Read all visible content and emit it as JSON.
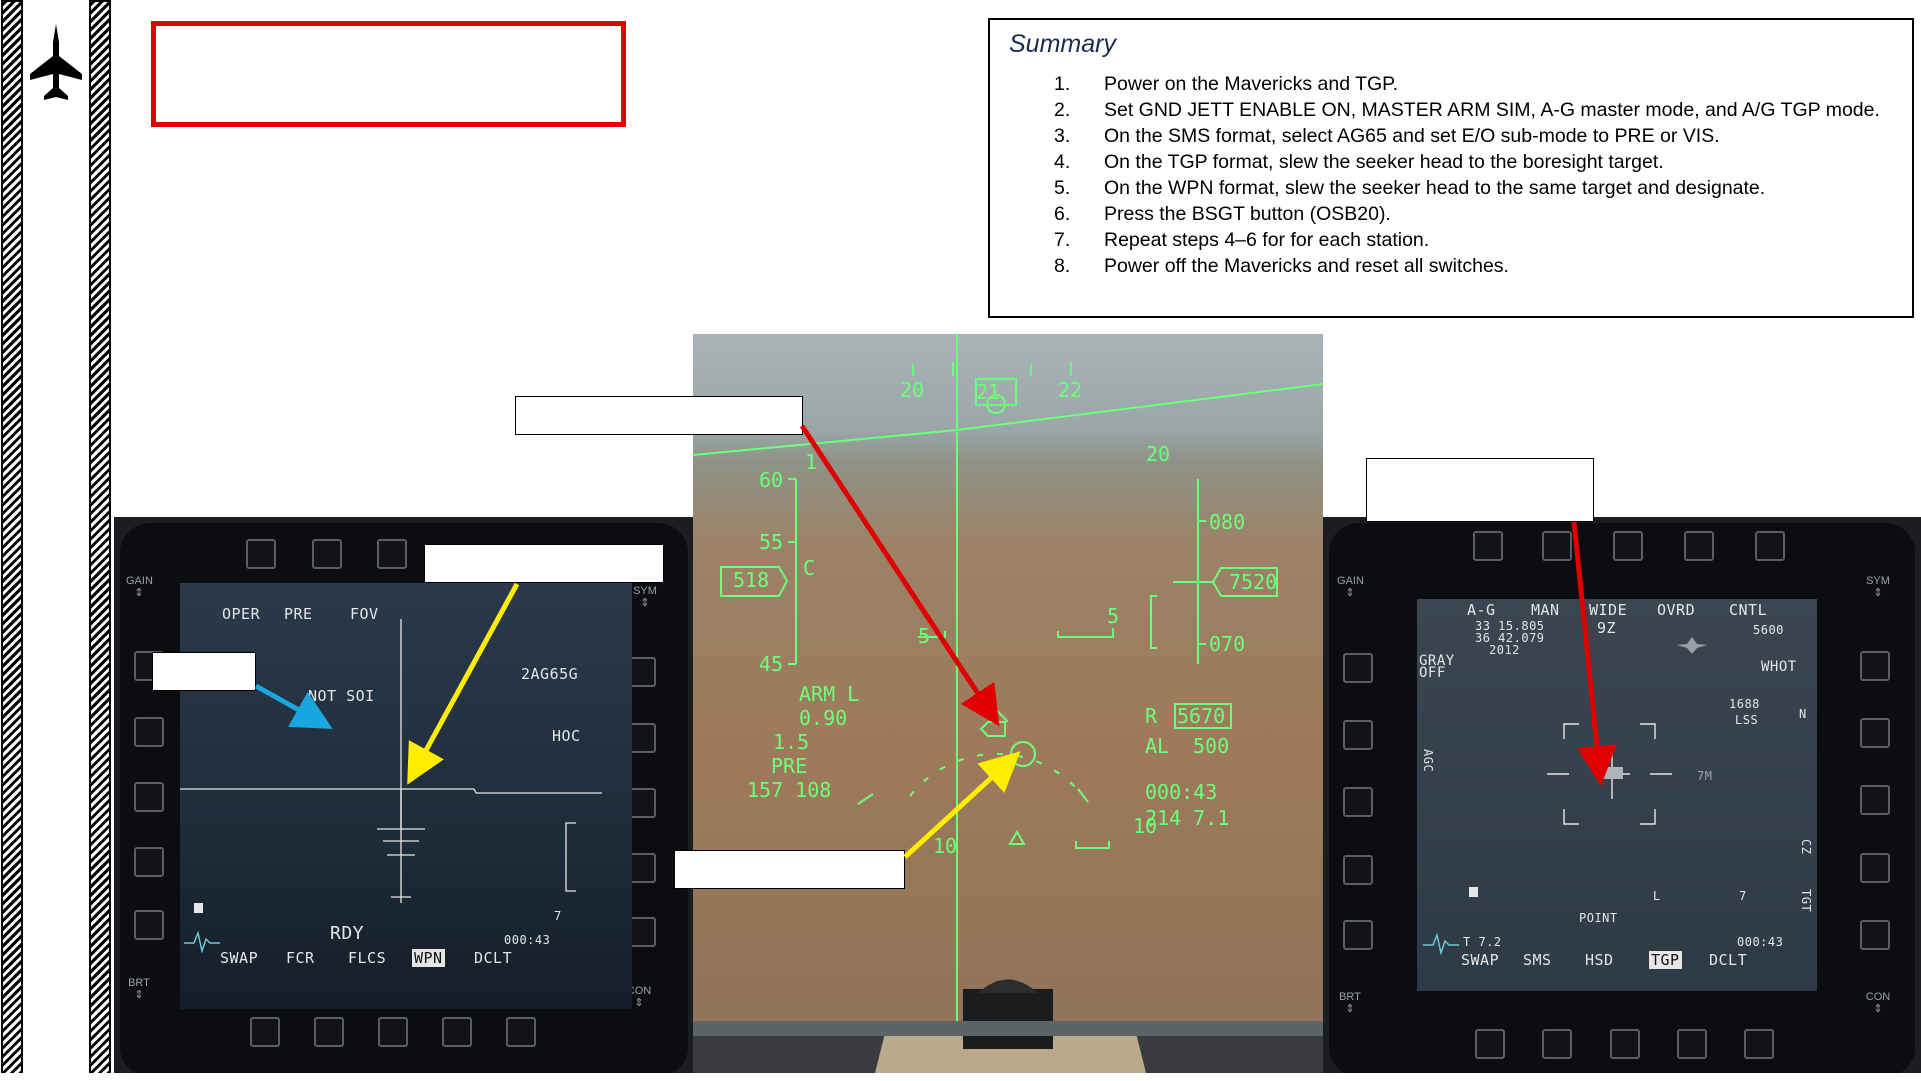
{
  "summary": {
    "title": "Summary",
    "steps": [
      {
        "num": "1.",
        "text": "Power on the Mavericks and TGP."
      },
      {
        "num": "2.",
        "text": "Set GND JETT ENABLE ON, MASTER ARM SIM, A-G master mode, and A/G TGP mode."
      },
      {
        "num": "3.",
        "text": "On the SMS format, select AG65 and set E/O sub-mode to PRE or VIS."
      },
      {
        "num": "4.",
        "text": "On the TGP format, slew the seeker head to the boresight target."
      },
      {
        "num": "5.",
        "text": "On the WPN format, slew the seeker head to the same target and designate."
      },
      {
        "num": "6.",
        "text": "Press the BSGT button (OSB20)."
      },
      {
        "num": "7.",
        "text": "Repeat steps 4–6 for for each station."
      },
      {
        "num": "8.",
        "text": "Power off the Mavericks and reset all switches."
      }
    ]
  },
  "mfd_labels": {
    "gain": "GAIN",
    "sym": "SYM",
    "brt": "BRT",
    "con": "CON"
  },
  "wpn_mfd": {
    "top": [
      "OPER",
      "PRE",
      "FOV"
    ],
    "not_soi": "NOT SOI",
    "station": "2AG65G",
    "hoc": "HOC",
    "rdy": "RDY",
    "count": "7",
    "time": "000:43",
    "bottom": [
      "SWAP",
      "FCR",
      "FLCS",
      "WPN",
      "DCLT"
    ]
  },
  "tgp_mfd": {
    "top": [
      "A-G",
      "MAN",
      "WIDE",
      "OVRD",
      "CNTL"
    ],
    "lat": "33 15.805",
    "lon": "36 42.079",
    "elev": "2012",
    "fov": "9Z",
    "alt": "5600",
    "gray": "GRAY",
    "off": "OFF",
    "whot": "WHOT",
    "lss_val": "1688",
    "lss": "LSS",
    "agc": "AGC",
    "n": "N",
    "czz": "CZ",
    "tgt": "TGT",
    "l": "L",
    "seven": "7",
    "point": "POINT",
    "t72": "T 7.2",
    "time": "000:43",
    "mark": "7M",
    "bottom": [
      "SWAP",
      "SMS",
      "HSD",
      "TGP",
      "DCLT"
    ]
  },
  "hud": {
    "heading": [
      "20",
      "21",
      "22"
    ],
    "speed_ticks": [
      "60",
      "55",
      "45"
    ],
    "speed": "518",
    "c": "C",
    "alt_ticks": [
      "20",
      "080",
      "070"
    ],
    "alt": "7520",
    "arm": "ARM L",
    "g": "0.90",
    "mach": "1.5",
    "pre": "PRE",
    "bottom_left": "157  108",
    "r": "R",
    "range": "5670",
    "al_label": "AL",
    "al": "500",
    "time": "000:43",
    "steer": "214 7.1",
    "pitch_5": "5",
    "pitch_5r": "5",
    "pitch_10": "10",
    "pitch_10r": "10",
    "pitch_1": "1"
  }
}
